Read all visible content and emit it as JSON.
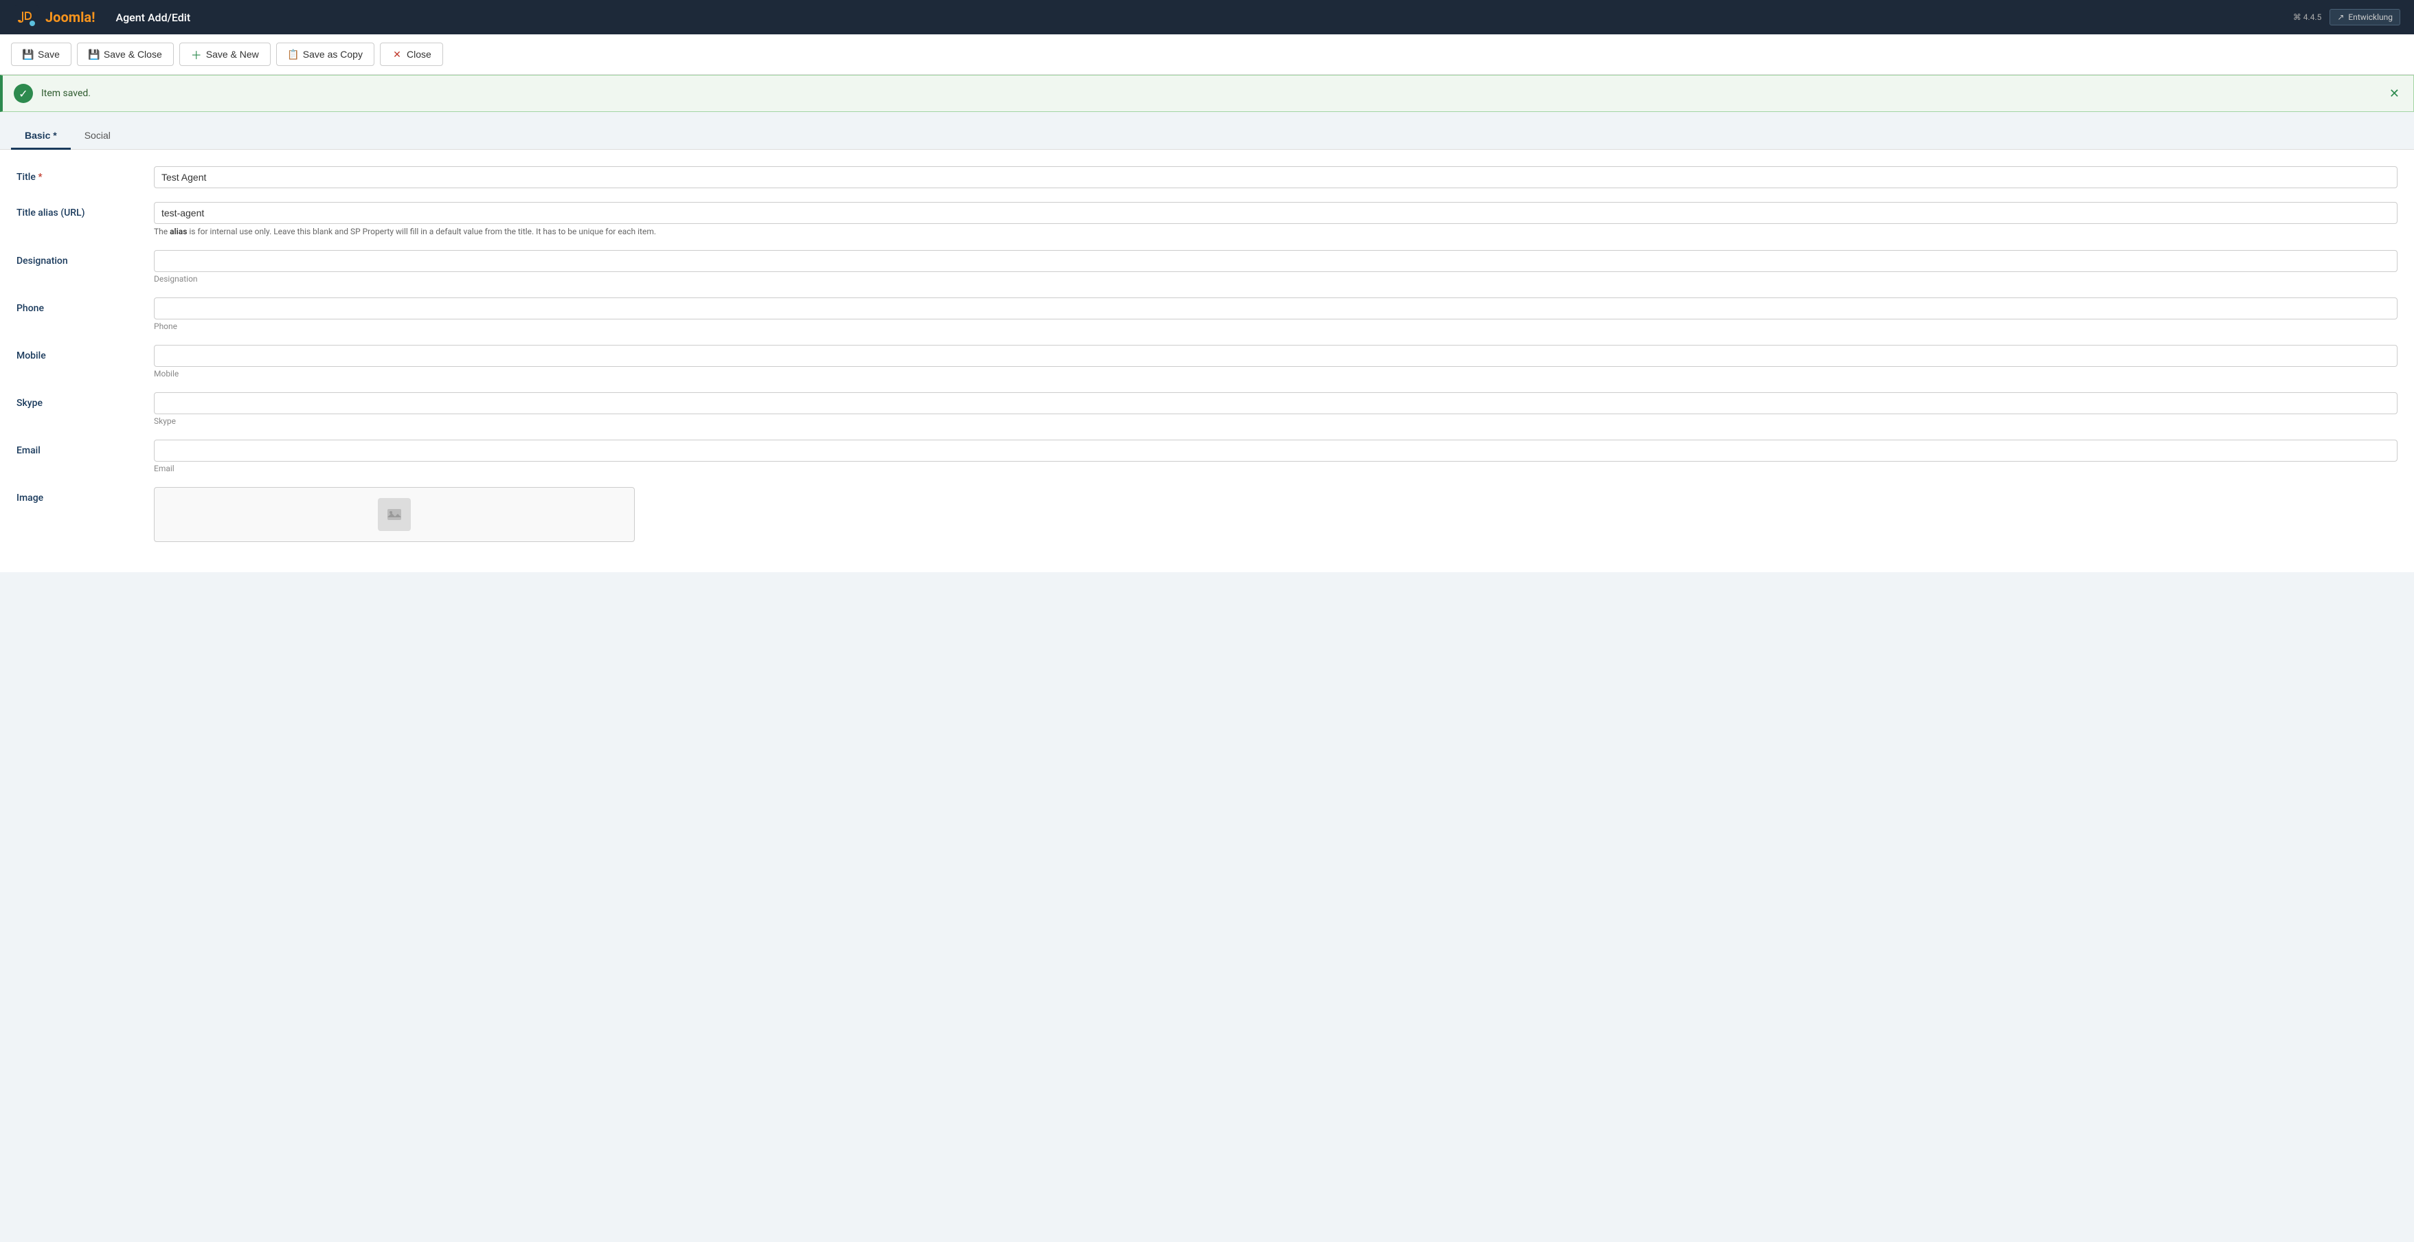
{
  "navbar": {
    "brand": "Joomla!",
    "title": "Agent Add/Edit",
    "version": "⌘ 4.4.5",
    "env_label": "Entwicklung"
  },
  "toolbar": {
    "save_label": "Save",
    "save_close_label": "Save & Close",
    "save_new_label": "Save & New",
    "save_copy_label": "Save as Copy",
    "close_label": "Close"
  },
  "alert": {
    "message": "Item saved."
  },
  "tabs": [
    {
      "id": "basic",
      "label": "Basic",
      "required": true,
      "active": true
    },
    {
      "id": "social",
      "label": "Social",
      "required": false,
      "active": false
    }
  ],
  "form": {
    "fields": [
      {
        "id": "title",
        "label": "Title",
        "required": true,
        "type": "text",
        "value": "Test Agent",
        "placeholder": "",
        "hint": ""
      },
      {
        "id": "alias",
        "label": "Title alias (URL)",
        "required": false,
        "type": "text",
        "value": "test-agent",
        "placeholder": "",
        "hint": "The alias is for internal use only. Leave this blank and SP Property will fill in a default value from the title. It has to be unique for each item.",
        "hint_bold": "alias"
      },
      {
        "id": "designation",
        "label": "Designation",
        "required": false,
        "type": "text",
        "value": "",
        "placeholder": "",
        "hint": "",
        "placeholder_hint": "Designation"
      },
      {
        "id": "phone",
        "label": "Phone",
        "required": false,
        "type": "text",
        "value": "",
        "placeholder": "",
        "hint": "",
        "placeholder_hint": "Phone"
      },
      {
        "id": "mobile",
        "label": "Mobile",
        "required": false,
        "type": "text",
        "value": "",
        "placeholder": "",
        "hint": "",
        "placeholder_hint": "Mobile"
      },
      {
        "id": "skype",
        "label": "Skype",
        "required": false,
        "type": "text",
        "value": "",
        "placeholder": "",
        "hint": "",
        "placeholder_hint": "Skype"
      },
      {
        "id": "email",
        "label": "Email",
        "required": false,
        "type": "text",
        "value": "",
        "placeholder": "",
        "hint": "",
        "placeholder_hint": "Email"
      },
      {
        "id": "image",
        "label": "Image",
        "required": false,
        "type": "image",
        "value": ""
      }
    ]
  },
  "colors": {
    "nav_bg": "#1d2939",
    "active_tab": "#1a3a5c",
    "success_green": "#2d8a4e",
    "alert_bg": "#f0f7f0"
  }
}
